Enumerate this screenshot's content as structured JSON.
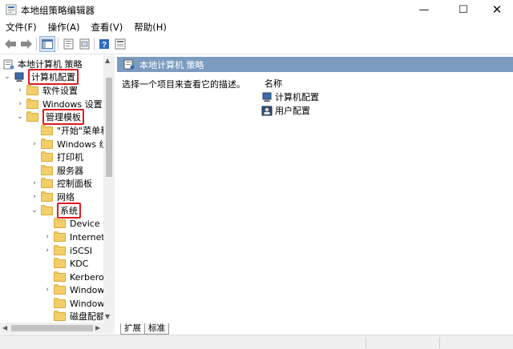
{
  "window": {
    "title": "本地组策略编辑器",
    "minimize_glyph": "—",
    "maximize_glyph": "☐",
    "close_glyph": "✕"
  },
  "menu": [
    {
      "label": "文件(F)"
    },
    {
      "label": "操作(A)"
    },
    {
      "label": "查看(V)"
    },
    {
      "label": "帮助(H)"
    }
  ],
  "toolbar": {
    "icons": [
      "back-arrow-icon",
      "forward-arrow-icon",
      "show-hide-tree-icon",
      "properties-icon",
      "export-list-icon",
      "help-icon",
      "filter-icon"
    ]
  },
  "tree": {
    "root": "本地计算机 策略",
    "items": [
      {
        "label": "计算机配置",
        "highlight": true
      },
      {
        "label": "软件设置"
      },
      {
        "label": "Windows 设置"
      },
      {
        "label": "管理模板",
        "highlight": true
      },
      {
        "label": "\"开始\"菜单和任"
      },
      {
        "label": "Windows 组件"
      },
      {
        "label": "打印机"
      },
      {
        "label": "服务器"
      },
      {
        "label": "控制面板"
      },
      {
        "label": "网络"
      },
      {
        "label": "系统",
        "highlight": true
      },
      {
        "label": "Device Gu"
      },
      {
        "label": "Internet 通"
      },
      {
        "label": "iSCSI"
      },
      {
        "label": "KDC"
      },
      {
        "label": "Kerberos"
      },
      {
        "label": "Windows"
      },
      {
        "label": "Windows"
      },
      {
        "label": "磁盘配额"
      }
    ]
  },
  "right": {
    "header_title": "本地计算机 策略",
    "description": "选择一个项目来查看它的描述。",
    "column_name": "名称",
    "items": [
      {
        "label": "计算机配置"
      },
      {
        "label": "用户配置"
      }
    ]
  },
  "tabs": [
    {
      "label": "扩展"
    },
    {
      "label": "标准"
    }
  ],
  "colors": {
    "header_bg": "#7b9bc1",
    "highlight_border": "#e0191f",
    "folder": "#f3cf6a"
  }
}
